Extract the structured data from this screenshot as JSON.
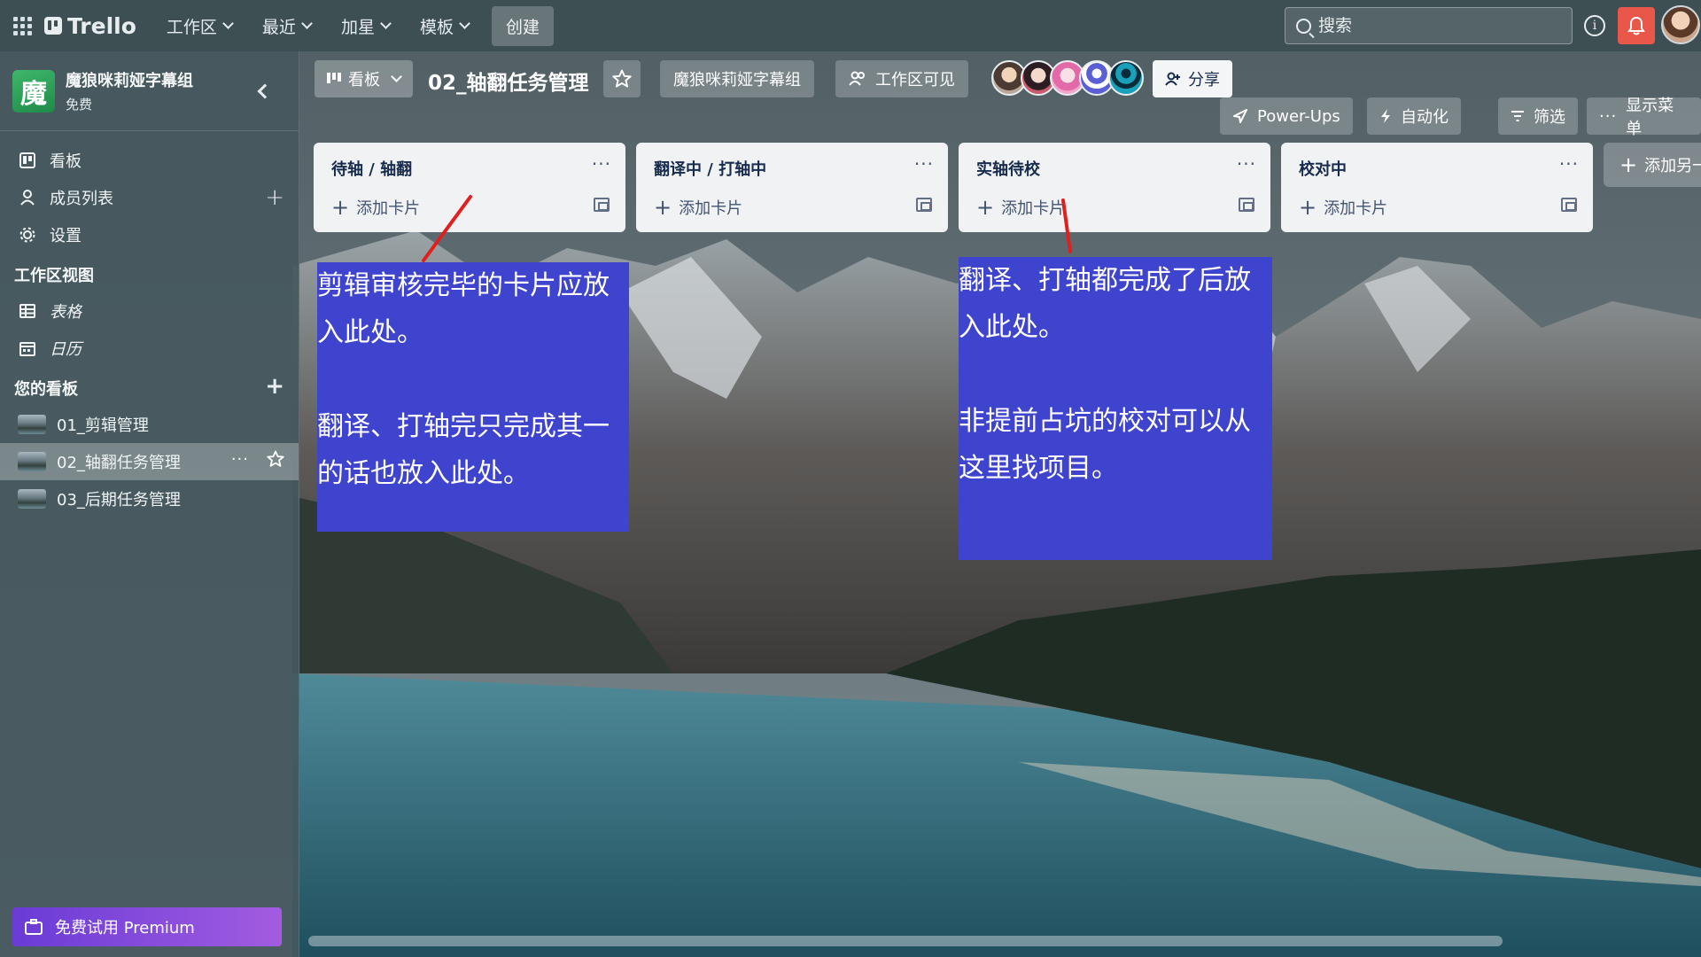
{
  "topnav": {
    "logo": "Trello",
    "menus": [
      "工作区",
      "最近",
      "加星",
      "模板"
    ],
    "create": "创建",
    "search_placeholder": "搜索"
  },
  "sidebar": {
    "workspace_initial": "魔",
    "workspace_name": "魔狼咪莉娅字幕组",
    "workspace_plan": "免费",
    "items": [
      "看板",
      "成员列表",
      "设置"
    ],
    "views_header": "工作区视图",
    "views": [
      "表格",
      "日历"
    ],
    "boards_header": "您的看板",
    "boards": [
      "01_剪辑管理",
      "02_轴翻任务管理",
      "03_后期任务管理"
    ],
    "active_board_index": 1,
    "premium": "免费试用 Premium"
  },
  "board": {
    "view": "看板",
    "title": "02_轴翻任务管理",
    "workspace": "魔狼咪莉娅字幕组",
    "visibility": "工作区可见",
    "share": "分享",
    "powerups": "Power-Ups",
    "automation": "自动化",
    "filter": "筛选",
    "menu": "显示菜单",
    "add_list": "添加另一",
    "lists": [
      {
        "title": "待轴 / 轴翻",
        "add_card": "添加卡片"
      },
      {
        "title": "翻译中 / 打轴中",
        "add_card": "添加卡片"
      },
      {
        "title": "实轴待校",
        "add_card": "添加卡片"
      },
      {
        "title": "校对中",
        "add_card": "添加卡片"
      }
    ]
  },
  "annotations": {
    "left": "剪辑审核完毕的卡片应放入此处。\n\n翻译、打轴完只完成其一的话也放入此处。",
    "right": "翻译、打轴都完成了后放入此处。\n\n非提前占坑的校对可以从这里找项目。",
    "color": "#3f44cf",
    "arrow_color": "#e01f1f"
  },
  "colors": {
    "topbar": "#3e4e54",
    "bell": "#e8574a",
    "premium_start": "#6a3bd6",
    "premium_end": "#a25ce0",
    "list_bg": "#f1f2f4"
  }
}
